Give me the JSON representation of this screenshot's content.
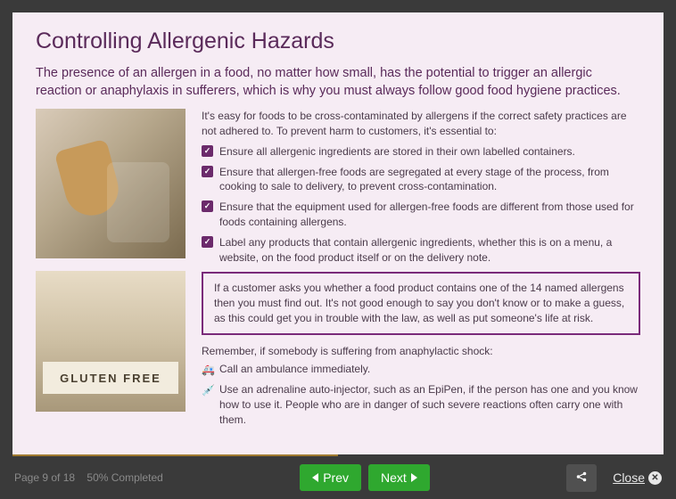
{
  "page": {
    "title": "Controlling Allergenic Hazards",
    "lead": "The presence of an allergen in a food, no matter how small, has the potential to trigger an allergic reaction or anaphylaxis in sufferers, which is why you must always follow good food hygiene practices.",
    "intro": "It's easy for foods to be cross-contaminated by allergens if the correct safety practices are not adhered to. To prevent harm to customers, it's essential to:",
    "checklist": [
      "Ensure all allergenic ingredients are stored in their own labelled containers.",
      "Ensure that allergen-free foods are segregated at every stage of the process, from cooking to sale to delivery, to prevent cross-contamination.",
      "Ensure that the equipment used for allergen-free foods are different from those used for foods containing allergens.",
      "Label any products that contain allergenic ingredients, whether this is on a menu, a website, on the food product itself or on the delivery note."
    ],
    "callout": "If a customer asks you whether a food product contains one of the 14 named allergens then you must find out. It's not good enough to say you don't know or to make a guess, as this could get you in trouble with the law, as well as put someone's life at risk.",
    "remember": "Remember, if somebody is suffering from anaphylactic shock:",
    "actions": [
      {
        "icon": "ambulance-icon",
        "text": "Call an ambulance immediately."
      },
      {
        "icon": "epipen-icon",
        "text": "Use an adrenaline auto-injector, such as an EpiPen, if the person has one and you know how to use it. People who are in danger of such severe reactions often carry one with them."
      }
    ],
    "img2_label": "GLUTEN FREE"
  },
  "footer": {
    "page_status": "Page 9 of 18",
    "percent_status": "50% Completed",
    "progress_pct": 50,
    "prev_label": "Prev",
    "next_label": "Next",
    "close_label": "Close"
  }
}
